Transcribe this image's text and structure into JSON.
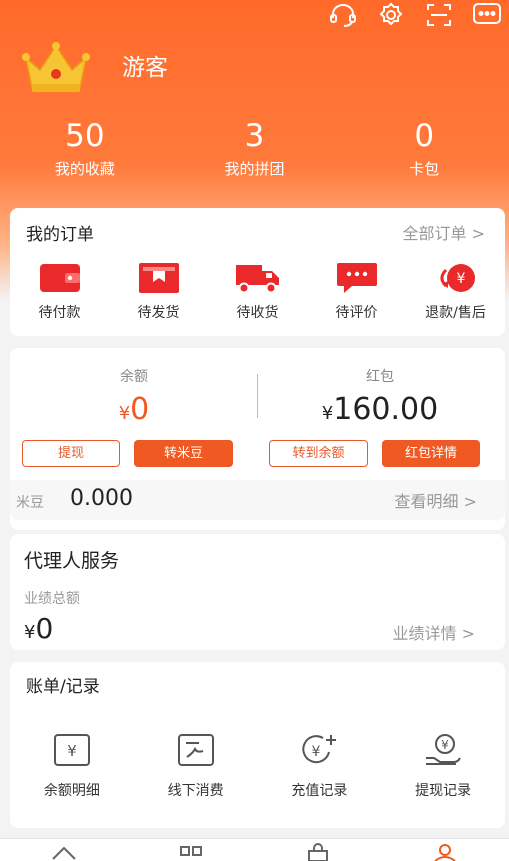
{
  "colors": {
    "primary": "#ff6a2a",
    "accent": "#f05a22",
    "muted": "#999999"
  },
  "header": {
    "icons": [
      "headset-icon",
      "gear-icon",
      "scan-icon",
      "message-icon"
    ],
    "username": "游客"
  },
  "stats": [
    {
      "value": "50",
      "label": "我的收藏"
    },
    {
      "value": "3",
      "label": "我的拼团"
    },
    {
      "value": "0",
      "label": "卡包"
    }
  ],
  "orders": {
    "title": "我的订单",
    "all_link": "全部订单 >",
    "items": [
      {
        "label": "待付款",
        "icon": "wallet-icon"
      },
      {
        "label": "待发货",
        "icon": "package-icon"
      },
      {
        "label": "待收货",
        "icon": "truck-icon"
      },
      {
        "label": "待评价",
        "icon": "comment-icon"
      },
      {
        "label": "退款/售后",
        "icon": "refund-icon"
      }
    ]
  },
  "wallet": {
    "balance_label": "余额",
    "balance_currency": "¥",
    "balance_value": "0",
    "redpacket_label": "红包",
    "redpacket_currency": "¥",
    "redpacket_value": "160.00",
    "buttons": {
      "withdraw": "提现",
      "to_mibean": "转米豆",
      "to_balance": "转到余额",
      "redpacket_detail": "红包详情"
    },
    "mibean_label": "米豆",
    "mibean_value": "0.000",
    "detail_link": "查看明细 >"
  },
  "agent": {
    "title": "代理人服务",
    "total_label": "业绩总额",
    "currency": "¥",
    "total_value": "0",
    "detail_link": "业绩详情 >"
  },
  "records": {
    "title": "账单/记录",
    "items": [
      {
        "label": "余额明细",
        "icon": "yen-card-icon"
      },
      {
        "label": "线下消费",
        "icon": "receipt-icon"
      },
      {
        "label": "充值记录",
        "icon": "recharge-icon"
      },
      {
        "label": "提现记录",
        "icon": "withdraw-hand-icon"
      }
    ]
  },
  "tabbar": [
    "home-icon",
    "category-icon",
    "cart-icon",
    "user-icon"
  ]
}
